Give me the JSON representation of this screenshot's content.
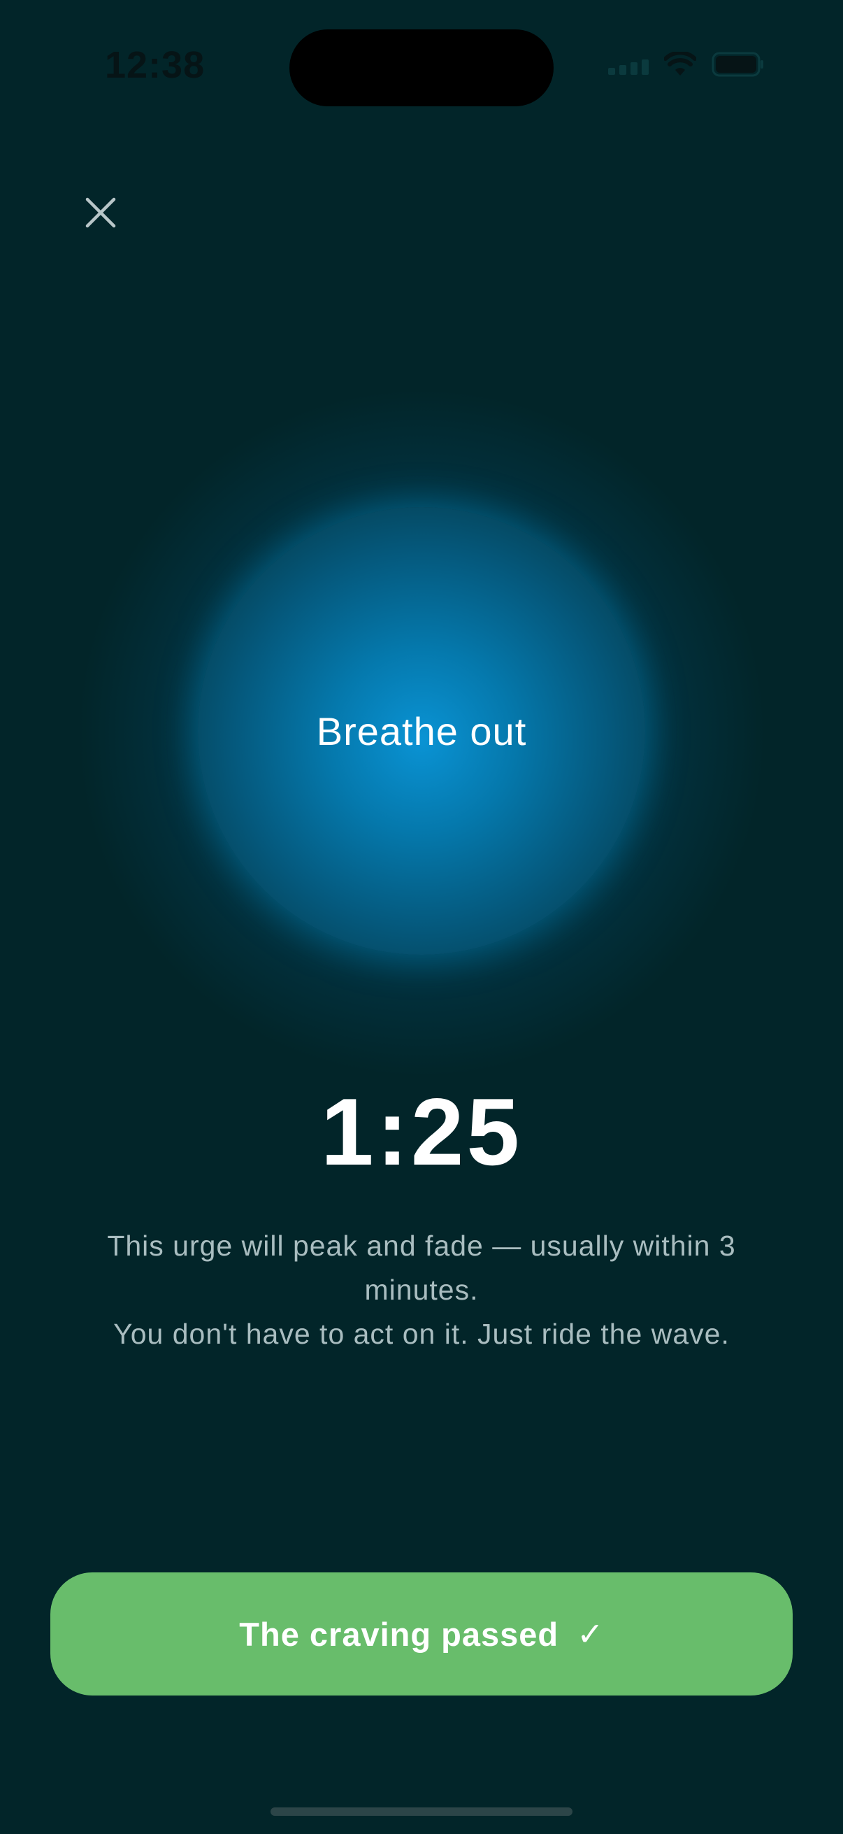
{
  "status_bar": {
    "time": "12:38",
    "wifi_icon": "wifi-icon",
    "battery_icon": "battery-icon",
    "signal_icon": "cellular-signal-icon"
  },
  "header": {
    "close_icon": "close-icon"
  },
  "breathing": {
    "label": "Breathe out"
  },
  "timer": {
    "value": "1:25"
  },
  "message": {
    "line1": "This urge will peak and fade — usually within 3 minutes.",
    "line2": "You don't have to act on it. Just ride the wave."
  },
  "cta": {
    "label": "The craving passed",
    "icon": "✓"
  },
  "colors": {
    "background": "#022529",
    "orb": "#0a93d4",
    "cta": "#68bd6b",
    "message_text": "#a9bdc0"
  }
}
